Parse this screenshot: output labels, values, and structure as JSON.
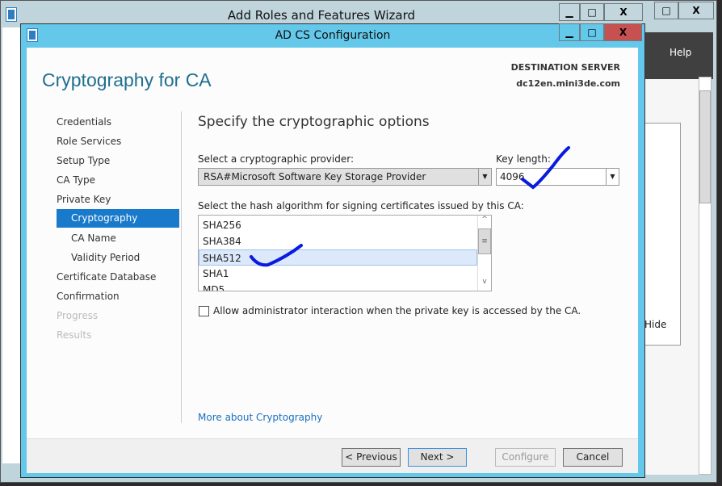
{
  "outer_window": {
    "title": "Add Roles and Features Wizard",
    "menu_help": "Help",
    "hide_label": "Hide"
  },
  "dialog": {
    "title": "AD CS Configuration",
    "minimize": "▁",
    "maximize": "□",
    "close": "X"
  },
  "header": {
    "page_title": "Cryptography for CA",
    "dest_label": "DESTINATION SERVER",
    "dest_server": "dc12en.mini3de.com"
  },
  "nav": {
    "items": [
      {
        "label": "Credentials",
        "state": "normal"
      },
      {
        "label": "Role Services",
        "state": "normal"
      },
      {
        "label": "Setup Type",
        "state": "normal"
      },
      {
        "label": "CA Type",
        "state": "normal"
      },
      {
        "label": "Private Key",
        "state": "normal"
      },
      {
        "label": "Cryptography",
        "state": "selected"
      },
      {
        "label": "CA Name",
        "state": "sub"
      },
      {
        "label": "Validity Period",
        "state": "sub"
      },
      {
        "label": "Certificate Database",
        "state": "normal"
      },
      {
        "label": "Confirmation",
        "state": "normal"
      },
      {
        "label": "Progress",
        "state": "disabled"
      },
      {
        "label": "Results",
        "state": "disabled"
      }
    ]
  },
  "main": {
    "heading": "Specify the cryptographic options",
    "provider_label": "Select a cryptographic provider:",
    "provider_value": "RSA#Microsoft Software Key Storage Provider",
    "key_length_label": "Key length:",
    "key_length_value": "4096",
    "hash_label": "Select the hash algorithm for signing certificates issued by this CA:",
    "hash_options": [
      "SHA256",
      "SHA384",
      "SHA512",
      "SHA1",
      "MD5"
    ],
    "hash_selected": "SHA512",
    "admin_checkbox_label": "Allow administrator interaction when the private key is accessed by the CA.",
    "admin_checked": false,
    "more_link": "More about Cryptography"
  },
  "footer": {
    "previous": "< Previous",
    "next": "Next >",
    "configure": "Configure",
    "cancel": "Cancel"
  },
  "colors": {
    "titlebar": "#63c8ea",
    "close": "#c75050",
    "selected": "#1979ca",
    "annotation": "#0a1adf"
  }
}
